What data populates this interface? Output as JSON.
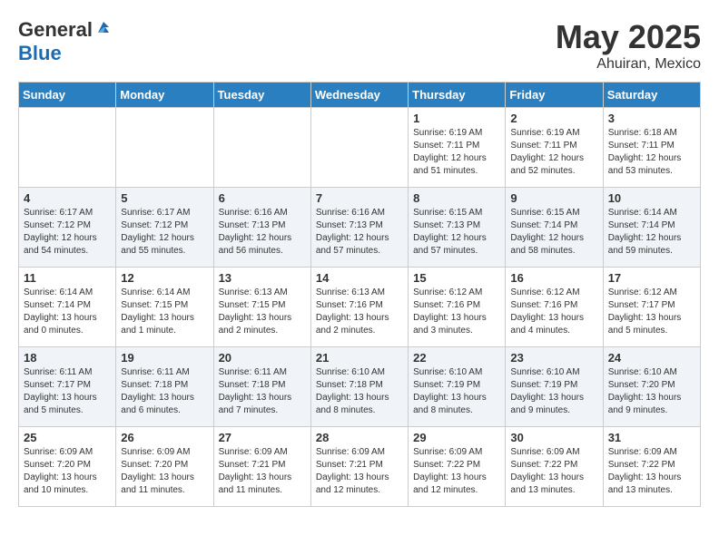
{
  "header": {
    "logo": {
      "general": "General",
      "blue": "Blue"
    },
    "title": "May 2025",
    "location": "Ahuiran, Mexico"
  },
  "days_of_week": [
    "Sunday",
    "Monday",
    "Tuesday",
    "Wednesday",
    "Thursday",
    "Friday",
    "Saturday"
  ],
  "weeks": [
    [
      {
        "num": "",
        "info": ""
      },
      {
        "num": "",
        "info": ""
      },
      {
        "num": "",
        "info": ""
      },
      {
        "num": "",
        "info": ""
      },
      {
        "num": "1",
        "info": "Sunrise: 6:19 AM\nSunset: 7:11 PM\nDaylight: 12 hours\nand 51 minutes."
      },
      {
        "num": "2",
        "info": "Sunrise: 6:19 AM\nSunset: 7:11 PM\nDaylight: 12 hours\nand 52 minutes."
      },
      {
        "num": "3",
        "info": "Sunrise: 6:18 AM\nSunset: 7:11 PM\nDaylight: 12 hours\nand 53 minutes."
      }
    ],
    [
      {
        "num": "4",
        "info": "Sunrise: 6:17 AM\nSunset: 7:12 PM\nDaylight: 12 hours\nand 54 minutes."
      },
      {
        "num": "5",
        "info": "Sunrise: 6:17 AM\nSunset: 7:12 PM\nDaylight: 12 hours\nand 55 minutes."
      },
      {
        "num": "6",
        "info": "Sunrise: 6:16 AM\nSunset: 7:13 PM\nDaylight: 12 hours\nand 56 minutes."
      },
      {
        "num": "7",
        "info": "Sunrise: 6:16 AM\nSunset: 7:13 PM\nDaylight: 12 hours\nand 57 minutes."
      },
      {
        "num": "8",
        "info": "Sunrise: 6:15 AM\nSunset: 7:13 PM\nDaylight: 12 hours\nand 57 minutes."
      },
      {
        "num": "9",
        "info": "Sunrise: 6:15 AM\nSunset: 7:14 PM\nDaylight: 12 hours\nand 58 minutes."
      },
      {
        "num": "10",
        "info": "Sunrise: 6:14 AM\nSunset: 7:14 PM\nDaylight: 12 hours\nand 59 minutes."
      }
    ],
    [
      {
        "num": "11",
        "info": "Sunrise: 6:14 AM\nSunset: 7:14 PM\nDaylight: 13 hours\nand 0 minutes."
      },
      {
        "num": "12",
        "info": "Sunrise: 6:14 AM\nSunset: 7:15 PM\nDaylight: 13 hours\nand 1 minute."
      },
      {
        "num": "13",
        "info": "Sunrise: 6:13 AM\nSunset: 7:15 PM\nDaylight: 13 hours\nand 2 minutes."
      },
      {
        "num": "14",
        "info": "Sunrise: 6:13 AM\nSunset: 7:16 PM\nDaylight: 13 hours\nand 2 minutes."
      },
      {
        "num": "15",
        "info": "Sunrise: 6:12 AM\nSunset: 7:16 PM\nDaylight: 13 hours\nand 3 minutes."
      },
      {
        "num": "16",
        "info": "Sunrise: 6:12 AM\nSunset: 7:16 PM\nDaylight: 13 hours\nand 4 minutes."
      },
      {
        "num": "17",
        "info": "Sunrise: 6:12 AM\nSunset: 7:17 PM\nDaylight: 13 hours\nand 5 minutes."
      }
    ],
    [
      {
        "num": "18",
        "info": "Sunrise: 6:11 AM\nSunset: 7:17 PM\nDaylight: 13 hours\nand 5 minutes."
      },
      {
        "num": "19",
        "info": "Sunrise: 6:11 AM\nSunset: 7:18 PM\nDaylight: 13 hours\nand 6 minutes."
      },
      {
        "num": "20",
        "info": "Sunrise: 6:11 AM\nSunset: 7:18 PM\nDaylight: 13 hours\nand 7 minutes."
      },
      {
        "num": "21",
        "info": "Sunrise: 6:10 AM\nSunset: 7:18 PM\nDaylight: 13 hours\nand 8 minutes."
      },
      {
        "num": "22",
        "info": "Sunrise: 6:10 AM\nSunset: 7:19 PM\nDaylight: 13 hours\nand 8 minutes."
      },
      {
        "num": "23",
        "info": "Sunrise: 6:10 AM\nSunset: 7:19 PM\nDaylight: 13 hours\nand 9 minutes."
      },
      {
        "num": "24",
        "info": "Sunrise: 6:10 AM\nSunset: 7:20 PM\nDaylight: 13 hours\nand 9 minutes."
      }
    ],
    [
      {
        "num": "25",
        "info": "Sunrise: 6:09 AM\nSunset: 7:20 PM\nDaylight: 13 hours\nand 10 minutes."
      },
      {
        "num": "26",
        "info": "Sunrise: 6:09 AM\nSunset: 7:20 PM\nDaylight: 13 hours\nand 11 minutes."
      },
      {
        "num": "27",
        "info": "Sunrise: 6:09 AM\nSunset: 7:21 PM\nDaylight: 13 hours\nand 11 minutes."
      },
      {
        "num": "28",
        "info": "Sunrise: 6:09 AM\nSunset: 7:21 PM\nDaylight: 13 hours\nand 12 minutes."
      },
      {
        "num": "29",
        "info": "Sunrise: 6:09 AM\nSunset: 7:22 PM\nDaylight: 13 hours\nand 12 minutes."
      },
      {
        "num": "30",
        "info": "Sunrise: 6:09 AM\nSunset: 7:22 PM\nDaylight: 13 hours\nand 13 minutes."
      },
      {
        "num": "31",
        "info": "Sunrise: 6:09 AM\nSunset: 7:22 PM\nDaylight: 13 hours\nand 13 minutes."
      }
    ]
  ]
}
